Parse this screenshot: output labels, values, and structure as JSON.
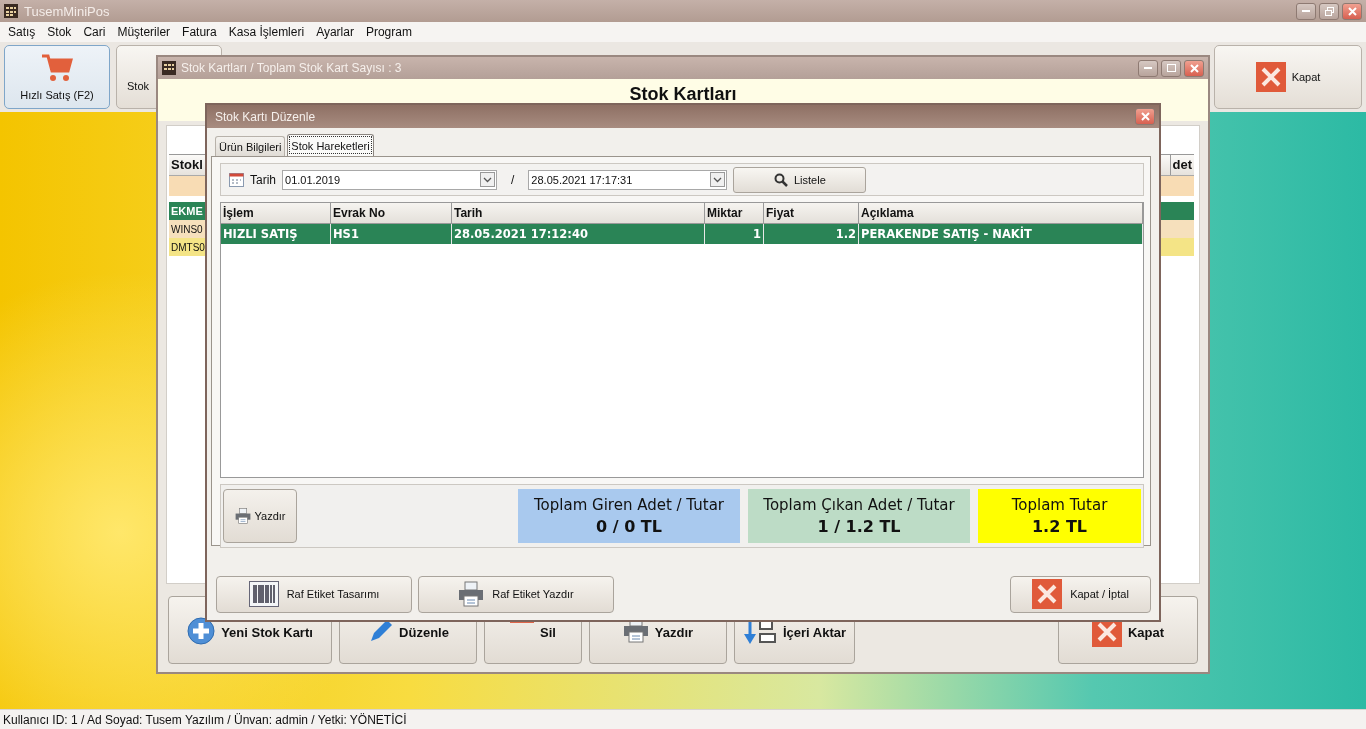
{
  "app": {
    "title": "TusemMiniPos"
  },
  "menu": [
    "Satış",
    "Stok",
    "Cari",
    "Müşteriler",
    "Fatura",
    "Kasa İşlemleri",
    "Ayarlar",
    "Program"
  ],
  "toolbar": {
    "buttons": [
      {
        "label": "Hızlı Satış (F2)",
        "selected": true
      },
      {
        "label": "Stok",
        "selected": false
      }
    ],
    "close_button": "Kapat"
  },
  "stock_window": {
    "title": "Stok Kartları / Toplam Stok Kart Sayısı : 3",
    "heading": "Stok Kartları",
    "grid": {
      "column_1": "Stokl",
      "column_last": "det",
      "rows": [
        {
          "cell": "EKME",
          "selected": true
        },
        {
          "cell": "WINS0",
          "selected": false
        },
        {
          "cell": "DMTS0",
          "selected": false
        }
      ]
    },
    "buttons": [
      "Yeni Stok Kartı",
      "Düzenle",
      "Sil",
      "Yazdır",
      "İçeri Aktar",
      "Kapat"
    ]
  },
  "dialog": {
    "title": "Stok Kartı Düzenle",
    "tabs": [
      {
        "label": "Ürün Bilgileri",
        "selected": false
      },
      {
        "label": "Stok Hareketleri",
        "selected": true
      }
    ],
    "filter": {
      "label": "Tarih",
      "start": "01.01.2019",
      "separator": "/",
      "end": "28.05.2021 17:17:31",
      "button": "Listele"
    },
    "table": {
      "columns": [
        "İşlem",
        "Evrak No",
        "Tarih",
        "Miktar",
        "Fiyat",
        "Açıklama"
      ],
      "rows": [
        {
          "cells": [
            "HIZLI SATIŞ",
            "HS1",
            "28.05.2021 17:12:40",
            "1",
            "1.2",
            "PERAKENDE SATIŞ - NAKİT"
          ],
          "selected": true
        }
      ]
    },
    "print_button": "Yazdır",
    "totals": [
      {
        "kind": "in",
        "title": "Toplam Giren Adet / Tutar",
        "value": "0 / 0 TL"
      },
      {
        "kind": "out",
        "title": "Toplam Çıkan Adet / Tutar",
        "value": "1 / 1.2 TL"
      },
      {
        "kind": "sum",
        "title": "Toplam Tutar",
        "value": "1.2 TL"
      }
    ],
    "buttons": [
      "Raf Etiket Tasarımı",
      "Raf Etiket Yazdır",
      "Kapat / İptal"
    ]
  },
  "status_bar": "Kullanıcı ID: 1 / Ad Soyad: Tusem Yazılım / Ünvan: admin / Yetki: YÖNETİCİ"
}
